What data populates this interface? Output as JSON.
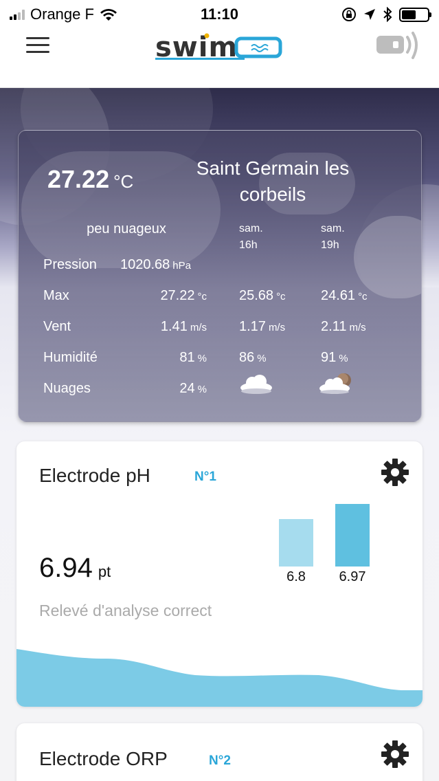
{
  "status_bar": {
    "carrier": "Orange F",
    "time": "11:10"
  },
  "header": {
    "logo_text": "swim",
    "menu_icon": "hamburger-icon",
    "remote_icon": "remote-signal-icon"
  },
  "weather": {
    "temperature": "27.22",
    "temp_unit": "°C",
    "city_line1": "Saint Germain les",
    "city_line2": "corbeils",
    "description": "peu nuageux",
    "forecasts": [
      {
        "day": "sam.",
        "hour": "16h",
        "max": "25.68",
        "wind": "1.17",
        "humidity": "86",
        "icon": "cloud-icon"
      },
      {
        "day": "sam.",
        "hour": "19h",
        "max": "24.61",
        "wind": "2.11",
        "humidity": "91",
        "icon": "cloud-night-icon"
      }
    ],
    "rows": {
      "pressure_label": "Pression",
      "pressure_value": "1020.68",
      "pressure_unit": "hPa",
      "max_label": "Max",
      "max_value": "27.22",
      "max_unit": "°c",
      "wind_label": "Vent",
      "wind_value": "1.41",
      "wind_unit": "m/s",
      "humidity_label": "Humidité",
      "humidity_value": "81",
      "humidity_unit": "%",
      "clouds_label": "Nuages",
      "clouds_value": "24",
      "clouds_unit": "%"
    }
  },
  "electrode_ph": {
    "title": "Electrode pH",
    "number": "N°1",
    "value": "6.94",
    "unit": "pt",
    "status": "Relevé d'analyse correct",
    "bars": [
      {
        "label": "6.8",
        "value": 6.8,
        "color": "#a6dcee"
      },
      {
        "label": "6.97",
        "value": 6.97,
        "color": "#5fc0e0"
      }
    ],
    "wave_color": "#7ccbe6"
  },
  "electrode_orp": {
    "title": "Electrode ORP",
    "number": "N°2"
  }
}
